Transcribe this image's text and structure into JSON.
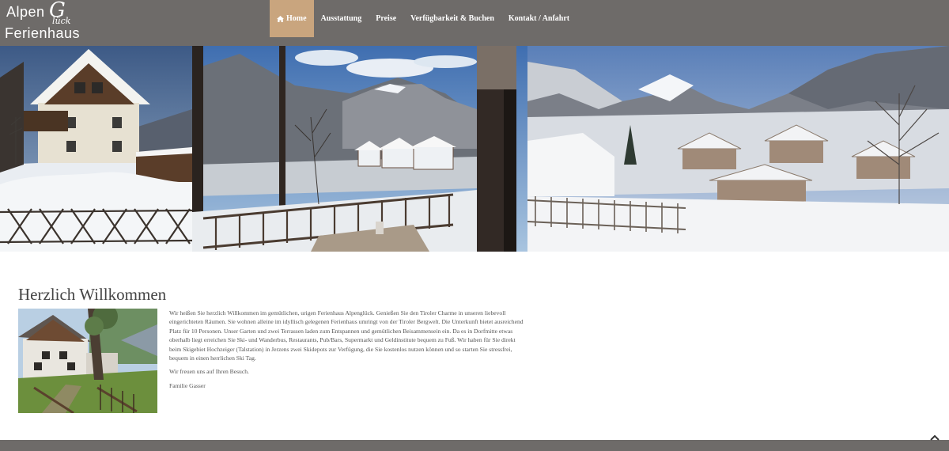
{
  "logo": {
    "word1": "Alpen",
    "word2": "Glück",
    "word3": "Ferienhaus"
  },
  "nav": {
    "items": [
      {
        "label": "Home",
        "icon": "home-icon",
        "active": true
      },
      {
        "label": "Ausstattung"
      },
      {
        "label": "Preise"
      },
      {
        "label": "Verfügbarkeit & Buchen"
      },
      {
        "label": "Kontakt / Anfahrt"
      }
    ]
  },
  "welcome": {
    "title": "Herzlich Willkommen",
    "paragraph1": "Wir heißen Sie herzlich Willkommen im gemütlichen, urigen Ferienhaus Alpenglück. Genießen Sie den Tiroler Charme in unseren liebevoll eingerichteten Räumen. Sie wohnen alleine im idyllisch gelegenen Ferienhaus umringt von der Tiroler Bergwelt. Die Unterkunft bietet ausreichend Platz für 10 Personen. Unser Garten und zwei Terrassen laden zum Entspannen und gemütlichen Beisammensein ein. Da es in Dorfmitte etwas oberhalb liegt erreichen Sie Ski- und Wanderbus, Restaurants, Pub/Bars, Supermarkt und Geldinstitute bequem zu Fuß. Wir haben für Sie direkt beim Skigebiet Hochzeiger (Talstation) in Jerzens zwei Skidepots zur Verfügung, die Sie kostenlos nutzen können und so starten Sie stressfrei, bequem in einen herrlichen Ski Tag.",
    "paragraph2": "Wir freuen uns auf Ihren Besuch.",
    "signature": "Familie Gasser"
  },
  "colors": {
    "navbar": "#6e6b69",
    "active": "#c9a57e",
    "footer": "#6e6b69"
  },
  "icons": {
    "home": "home-icon",
    "totop": "chevron-up-icon"
  }
}
